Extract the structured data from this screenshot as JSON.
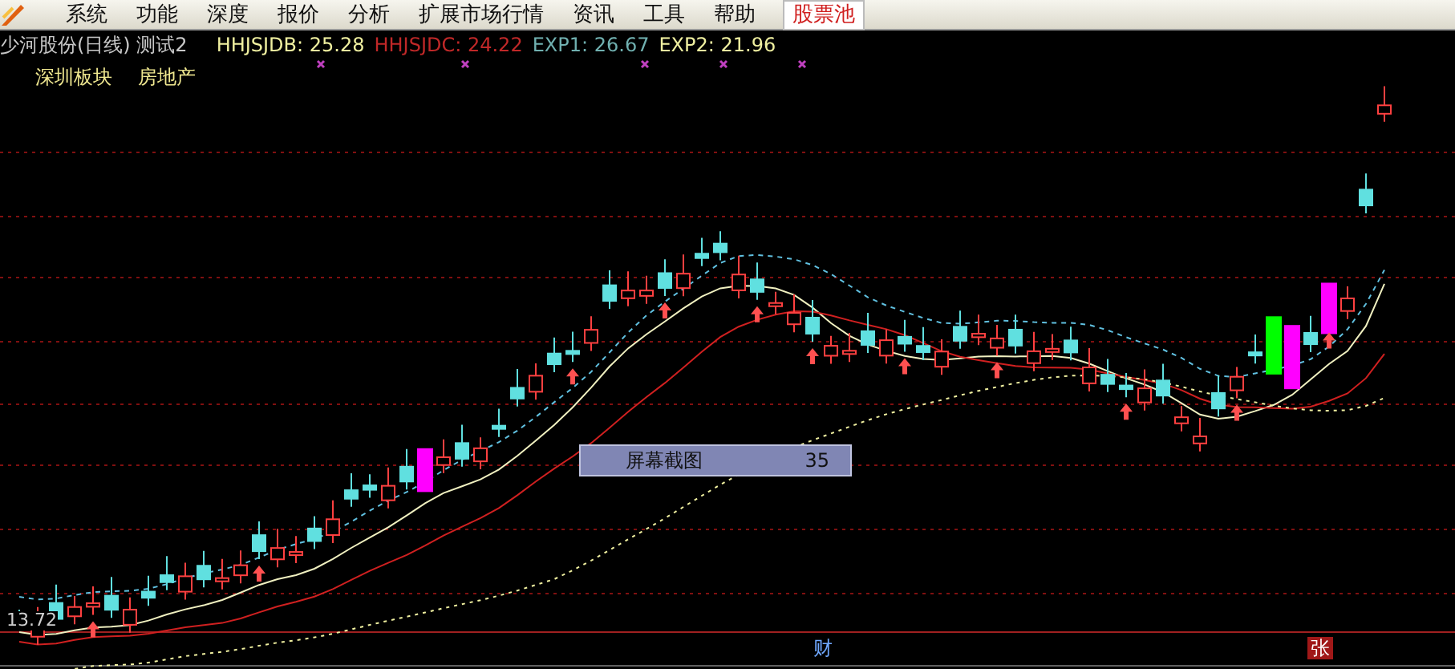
{
  "menu": [
    {
      "label": "系统",
      "selected": false
    },
    {
      "label": "功能",
      "selected": false
    },
    {
      "label": "深度",
      "selected": false
    },
    {
      "label": "报价",
      "selected": false
    },
    {
      "label": "分析",
      "selected": false
    },
    {
      "label": "扩展市场行情",
      "selected": false
    },
    {
      "label": "资讯",
      "selected": false
    },
    {
      "label": "工具",
      "selected": false
    },
    {
      "label": "帮助",
      "selected": false
    },
    {
      "label": "股票池",
      "selected": true
    }
  ],
  "chart": {
    "title": "少河股份(日线) 测试2",
    "indicators": [
      {
        "label": "HHJSJDB: 25.28",
        "color": "#f0f0a0"
      },
      {
        "label": "HHJSJDC: 24.22",
        "color": "#c02828"
      },
      {
        "label": "EXP1: 26.67",
        "color": "#70b0b0"
      },
      {
        "label": "EXP2: 21.96",
        "color": "#f0f0a0"
      }
    ],
    "tags": [
      "深圳板块",
      "房地产"
    ],
    "price_label": "13.72",
    "tooltip": {
      "label": "屏幕截图",
      "value": "35"
    },
    "markers": [
      {
        "label": "财",
        "kind": "info"
      },
      {
        "label": "张",
        "kind": "limit"
      }
    ]
  }
}
